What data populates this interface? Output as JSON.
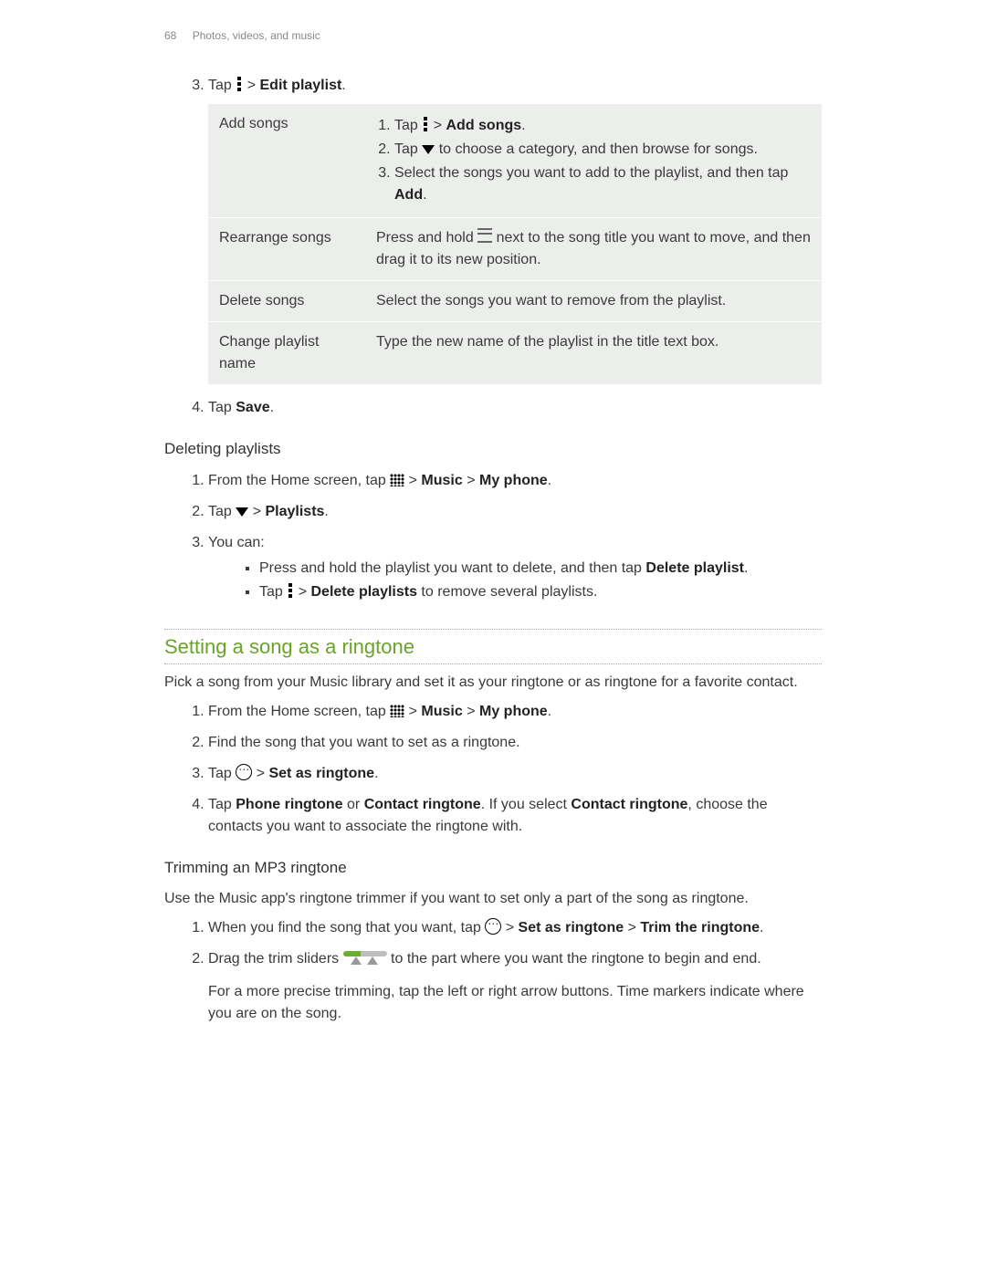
{
  "header": {
    "page_num": "68",
    "section": "Photos, videos, and music"
  },
  "step3": {
    "num": "3.",
    "pre": "Tap ",
    "post1": " > ",
    "bold": "Edit playlist",
    "post2": "."
  },
  "table": {
    "r1": {
      "label": "Add songs",
      "li1_pre": "Tap ",
      "li1_post1": " > ",
      "li1_bold": "Add songs",
      "li1_post2": ".",
      "li2_pre": "Tap ",
      "li2_post": " to choose a category, and then browse for songs.",
      "li3_pre": "Select the songs you want to add to the playlist, and then tap ",
      "li3_bold": "Add",
      "li3_post": "."
    },
    "r2": {
      "label": "Rearrange songs",
      "pre": "Press and hold ",
      "post": " next to the song title you want to move, and then drag it to its new position."
    },
    "r3": {
      "label": "Delete songs",
      "text": "Select the songs you want to remove from the playlist."
    },
    "r4": {
      "label": "Change playlist name",
      "text": "Type the new name of the playlist in the title text box."
    }
  },
  "step4": {
    "num": "4.",
    "pre": "Tap ",
    "bold": "Save",
    "post": "."
  },
  "del": {
    "heading": "Deleting playlists",
    "s1_pre": "From the Home screen, tap ",
    "s1_post1": " > ",
    "s1_b1": "Music",
    "s1_post2": " > ",
    "s1_b2": "My phone",
    "s1_post3": ".",
    "s2_pre": "Tap ",
    "s2_post1": " > ",
    "s2_bold": "Playlists",
    "s2_post2": ".",
    "s3": "You can:",
    "b1_pre": "Press and hold the playlist you want to delete, and then tap ",
    "b1_bold": "Delete playlist",
    "b1_post": ".",
    "b2_pre": "Tap ",
    "b2_post1": " > ",
    "b2_bold": "Delete playlists",
    "b2_post2": " to remove several playlists."
  },
  "ring": {
    "heading": "Setting a song as a ringtone",
    "intro": "Pick a song from your Music library and set it as your ringtone or as ringtone for a favorite contact.",
    "s1_pre": "From the Home screen, tap ",
    "s1_post1": " > ",
    "s1_b1": "Music",
    "s1_post2": " > ",
    "s1_b2": "My phone",
    "s1_post3": ".",
    "s2": "Find the song that you want to set as a ringtone.",
    "s3_pre": "Tap ",
    "s3_post1": " > ",
    "s3_bold": "Set as ringtone",
    "s3_post2": ".",
    "s4_pre": "Tap ",
    "s4_b1": "Phone ringtone",
    "s4_mid1": " or ",
    "s4_b2": "Contact ringtone",
    "s4_mid2": ". If you select ",
    "s4_b3": "Contact ringtone",
    "s4_post": ", choose the contacts you want to associate the ringtone with."
  },
  "trim": {
    "heading": "Trimming an MP3 ringtone",
    "intro": "Use the Music app's ringtone trimmer if you want to set only a part of the song as ringtone.",
    "s1_pre": "When you find the song that you want, tap ",
    "s1_post1": " > ",
    "s1_b1": "Set as ringtone",
    "s1_post2": " > ",
    "s1_b2": "Trim the ringtone",
    "s1_post3": ".",
    "s2_pre": "Drag the trim sliders ",
    "s2_post": " to the part where you want the ringtone to begin and end.",
    "s2_extra": "For a more precise trimming, tap the left or right arrow buttons. Time markers indicate where you are on the song."
  }
}
